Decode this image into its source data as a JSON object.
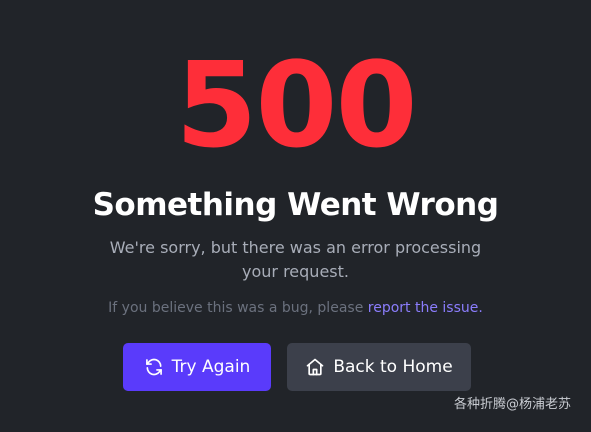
{
  "error": {
    "code": "500",
    "title": "Something Went Wrong",
    "description": "We're sorry, but there was an error processing your request.",
    "bug_prefix": "If you believe this was a bug, please ",
    "bug_link": "report the issue."
  },
  "actions": {
    "retry_label": "Try Again",
    "retry_icon": "refresh-icon",
    "home_label": "Back to Home",
    "home_icon": "home-icon"
  },
  "watermark": "各种折腾@杨浦老苏",
  "colors": {
    "background": "#212429",
    "error_code": "#fe2e39",
    "primary_button": "#5a3bfb",
    "secondary_button": "#3c404b",
    "link": "#8b7dfc"
  }
}
